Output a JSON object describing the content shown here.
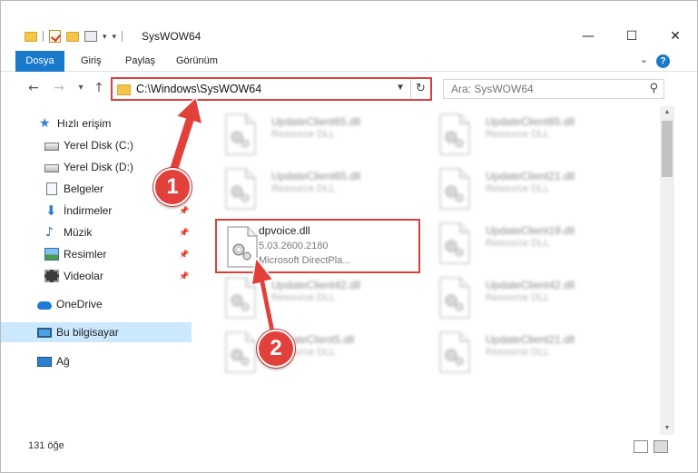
{
  "window": {
    "title": "SysWOW64",
    "controls": {
      "minimize": "—",
      "maximize": "☐",
      "close": "✕"
    }
  },
  "ribbon": {
    "tabs": [
      "Dosya",
      "Giriş",
      "Paylaş",
      "Görünüm"
    ],
    "help": "?"
  },
  "navigation": {
    "back": "←",
    "forward": "→",
    "recent": "▾",
    "up": "↑",
    "address": "C:\\Windows\\SysWOW64",
    "refresh": "↻",
    "search_placeholder": "Ara: SysWOW64"
  },
  "sidebar": {
    "items": [
      {
        "label": "Hızlı erişim",
        "icon": "star-icon"
      },
      {
        "label": "Yerel Disk (C:)",
        "icon": "drive-icon"
      },
      {
        "label": "Yerel Disk (D:)",
        "icon": "drive-icon"
      },
      {
        "label": "Belgeler",
        "icon": "documents-icon"
      },
      {
        "label": "İndirmeler",
        "icon": "downloads-icon",
        "pinned": true
      },
      {
        "label": "Müzik",
        "icon": "music-icon",
        "pinned": true
      },
      {
        "label": "Resimler",
        "icon": "pictures-icon",
        "pinned": true
      },
      {
        "label": "Videolar",
        "icon": "videos-icon",
        "pinned": true
      },
      {
        "label": "OneDrive",
        "icon": "onedrive-icon"
      },
      {
        "label": "Bu bilgisayar",
        "icon": "this-pc-icon",
        "selected": true
      },
      {
        "label": "Ağ",
        "icon": "network-icon"
      }
    ]
  },
  "files": [
    {
      "name": "UpdateClient65.dll",
      "desc1": "Resource DLL"
    },
    {
      "name": "UpdateClient65.dll",
      "desc1": "Resource DLL"
    },
    {
      "name": "UpdateClient65.dll",
      "desc1": "Resource DLL"
    },
    {
      "name": "UpdateClient21.dll",
      "desc1": "Resource DLL"
    },
    {
      "name": "dpvoice.dll",
      "desc1": "5.03.2600.2180",
      "desc2": "Microsoft DirectPla..."
    },
    {
      "name": "UpdateClient19.dll",
      "desc1": "Resource DLL"
    },
    {
      "name": "UpdateClient42.dll",
      "desc1": "Resource DLL"
    },
    {
      "name": "UpdateClient42.dll",
      "desc1": "Resource DLL"
    },
    {
      "name": "UpdateClient5.dll",
      "desc1": "Resource DLL"
    },
    {
      "name": "UpdateClient21.dll",
      "desc1": "Resource DLL"
    }
  ],
  "status": {
    "item_count": "131 öğe"
  },
  "annotations": {
    "step1": "1",
    "step2": "2",
    "color": "#e2403b"
  }
}
